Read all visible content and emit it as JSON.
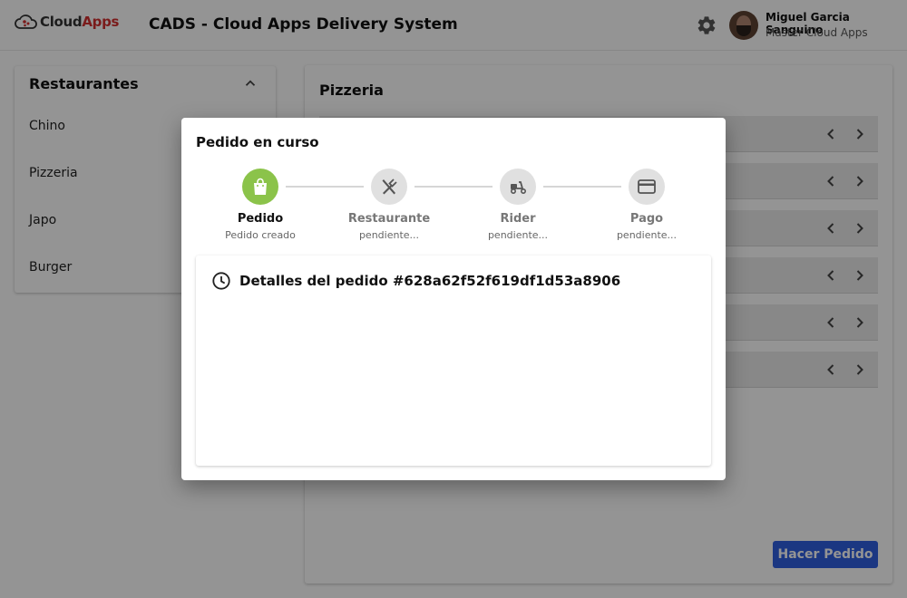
{
  "header": {
    "logo_text_part1": "Cloud",
    "logo_text_part2": "Apps",
    "title": "CADS - Cloud Apps Delivery System",
    "user": {
      "name": "Miguel Garcia Sanguino",
      "role": "Master Cloud Apps"
    },
    "icons": {
      "settings": "gear-icon",
      "avatar": "user-avatar"
    }
  },
  "restaurants": {
    "title": "Restaurantes",
    "collapse_icon": "chevron-up-icon",
    "items": [
      "Chino",
      "Pizzeria",
      "Japo",
      "Burger"
    ]
  },
  "menu": {
    "title": "Pizzeria",
    "rows": [
      {
        "prev_icon": "chevron-left-icon",
        "next_icon": "chevron-right-icon"
      },
      {
        "prev_icon": "chevron-left-icon",
        "next_icon": "chevron-right-icon"
      },
      {
        "prev_icon": "chevron-left-icon",
        "next_icon": "chevron-right-icon"
      },
      {
        "prev_icon": "chevron-left-icon",
        "next_icon": "chevron-right-icon"
      },
      {
        "prev_icon": "chevron-left-icon",
        "next_icon": "chevron-right-icon"
      },
      {
        "prev_icon": "chevron-left-icon",
        "next_icon": "chevron-right-icon"
      }
    ],
    "order_button": "Hacer Pedido"
  },
  "modal": {
    "title": "Pedido en curso",
    "steps": [
      {
        "label": "Pedido",
        "status": "Pedido creado",
        "icon": "shopping-bag-icon",
        "active": true
      },
      {
        "label": "Restaurante",
        "status": "pendiente...",
        "icon": "utensils-icon",
        "active": false
      },
      {
        "label": "Rider",
        "status": "pendiente...",
        "icon": "scooter-icon",
        "active": false
      },
      {
        "label": "Pago",
        "status": "pendiente...",
        "icon": "credit-card-icon",
        "active": false
      }
    ],
    "details": {
      "icon": "clock-icon",
      "title": "Detalles del pedido #628a62f52f619df1d53a8906"
    }
  },
  "colors": {
    "accent": "#2f5fe0",
    "step_active": "#8bc34a",
    "logo_red": "#d32f2f"
  }
}
